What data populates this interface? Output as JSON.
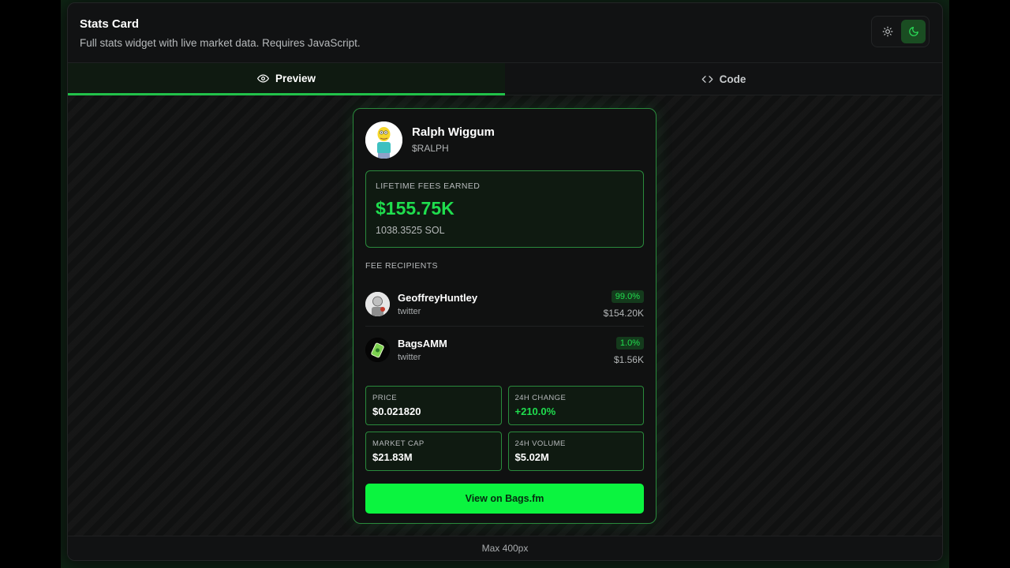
{
  "header": {
    "title": "Stats Card",
    "subtitle": "Full stats widget with live market data. Requires JavaScript."
  },
  "theme_toggle": {
    "options": [
      {
        "icon": "sun-icon",
        "active": false
      },
      {
        "icon": "moon-icon",
        "active": true
      }
    ]
  },
  "tabs": [
    {
      "label": "Preview",
      "icon": "eye-icon",
      "active": true
    },
    {
      "label": "Code",
      "icon": "code-icon",
      "active": false
    }
  ],
  "card": {
    "name": "Ralph Wiggum",
    "ticker": "$RALPH",
    "lifetime_fees": {
      "label": "LIFETIME FEES EARNED",
      "value": "$155.75K",
      "sol": "1038.3525 SOL"
    },
    "recipients_label": "FEE RECIPIENTS",
    "recipients": [
      {
        "name": "GeoffreyHuntley",
        "source": "twitter",
        "percent": "99.0%",
        "amount": "$154.20K"
      },
      {
        "name": "BagsAMM",
        "source": "twitter",
        "percent": "1.0%",
        "amount": "$1.56K"
      }
    ],
    "stats": [
      {
        "label": "PRICE",
        "value": "$0.021820"
      },
      {
        "label": "24H CHANGE",
        "value": "+210.0%"
      },
      {
        "label": "MARKET CAP",
        "value": "$21.83M"
      },
      {
        "label": "24H VOLUME",
        "value": "$5.02M"
      }
    ],
    "cta_label": "View on Bags.fm"
  },
  "footer": {
    "label": "Max 400px"
  },
  "colors": {
    "accent": "#0bf43f",
    "positive": "#1fde4e",
    "border": "#2a8a3c"
  }
}
